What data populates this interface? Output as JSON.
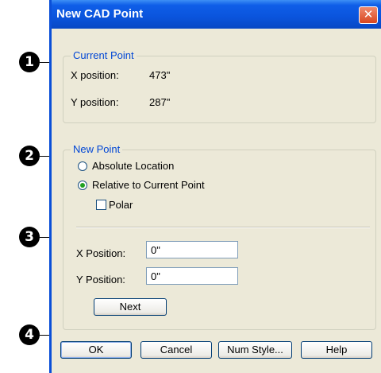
{
  "dialog": {
    "title": "New CAD Point",
    "close_glyph": "✕"
  },
  "current_point": {
    "legend": "Current Point",
    "x_label": "X position:",
    "x_value": "473\"",
    "y_label": "Y position:",
    "y_value": "287\""
  },
  "new_point": {
    "legend": "New Point",
    "absolute_label": "Absolute Location",
    "absolute_selected": false,
    "relative_label": "Relative to Current Point",
    "relative_selected": true,
    "polar_label": "Polar",
    "polar_checked": false,
    "x_position_label": "X Position:",
    "x_position_value": "0\"",
    "y_position_label": "Y Position:",
    "y_position_value": "0\"",
    "next_label": "Next"
  },
  "buttons": {
    "ok": "OK",
    "cancel": "Cancel",
    "num_style": "Num Style...",
    "help": "Help"
  },
  "callouts": [
    "1",
    "2",
    "3",
    "4"
  ]
}
